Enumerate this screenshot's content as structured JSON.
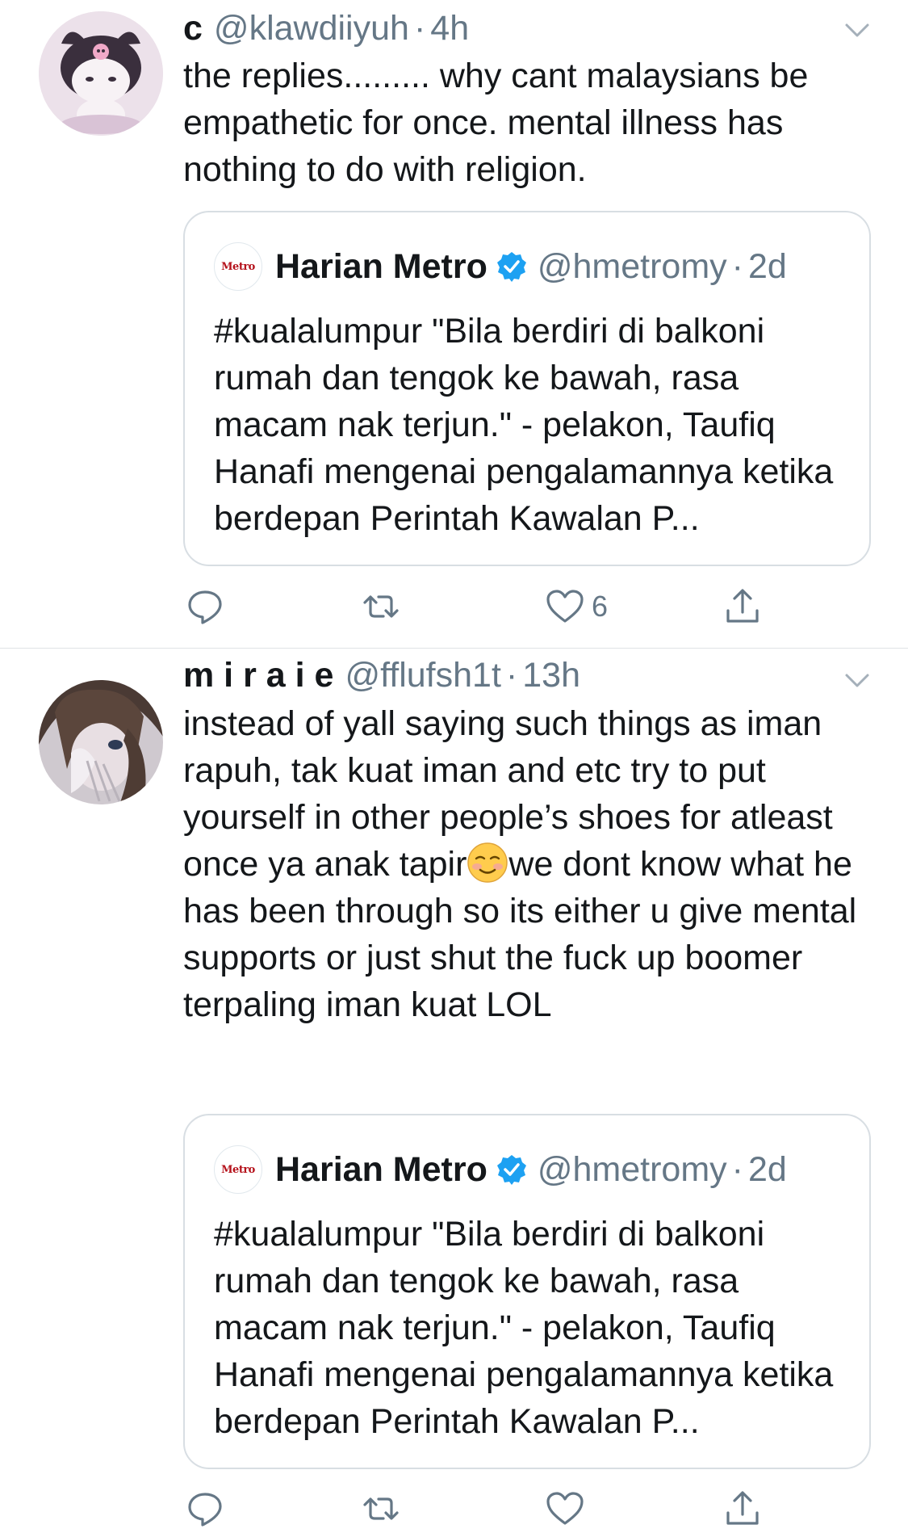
{
  "tweets": [
    {
      "name": "c",
      "handle": "@klawdiiyuh",
      "separator": "·",
      "time": "4h",
      "text": "the replies......... why cant malaysians be empathetic for once. mental illness has nothing to do with religion.",
      "quote": {
        "logo_text": "Metro",
        "name": "Harian Metro",
        "handle": "@hmetromy",
        "separator": "·",
        "time": "2d",
        "text": "#kualalumpur \"Bila berdiri di balkoni rumah dan tengok ke bawah, rasa macam nak terjun.\" - pelakon, Taufiq Hanafi mengenai pengalamannya ketika berdepan Perintah Kawalan P..."
      },
      "actions": {
        "reply_count": "",
        "retweet_count": "",
        "like_count": "6"
      },
      "avatar_icon": "kuromi-avatar"
    },
    {
      "name": "m i r a i e",
      "handle": "@fflufsh1t",
      "separator": "·",
      "time": "13h",
      "text_before_emoji": "instead of yall saying such things as iman rapuh, tak kuat iman and etc try to put yourself in other people’s shoes for atleast once ya anak tapir",
      "emoji": "smiling-face-emoji",
      "text_after_emoji": "we dont know what he has been through so its either u give mental supports or just shut the fuck up boomer terpaling iman kuat LOL",
      "quote": {
        "logo_text": "Metro",
        "name": "Harian Metro",
        "handle": "@hmetromy",
        "separator": "·",
        "time": "2d",
        "text": "#kualalumpur \"Bila berdiri di balkoni rumah dan tengok ke bawah, rasa macam nak terjun.\" - pelakon, Taufiq Hanafi mengenai pengalamannya ketika berdepan Perintah Kawalan P..."
      },
      "actions": {
        "reply_count": "",
        "retweet_count": "",
        "like_count": ""
      },
      "avatar_icon": "anime-girl-avatar"
    }
  ],
  "colors": {
    "text": "#14171a",
    "secondary": "#657786",
    "verified": "#1da1f2",
    "border": "#d8dee3"
  }
}
